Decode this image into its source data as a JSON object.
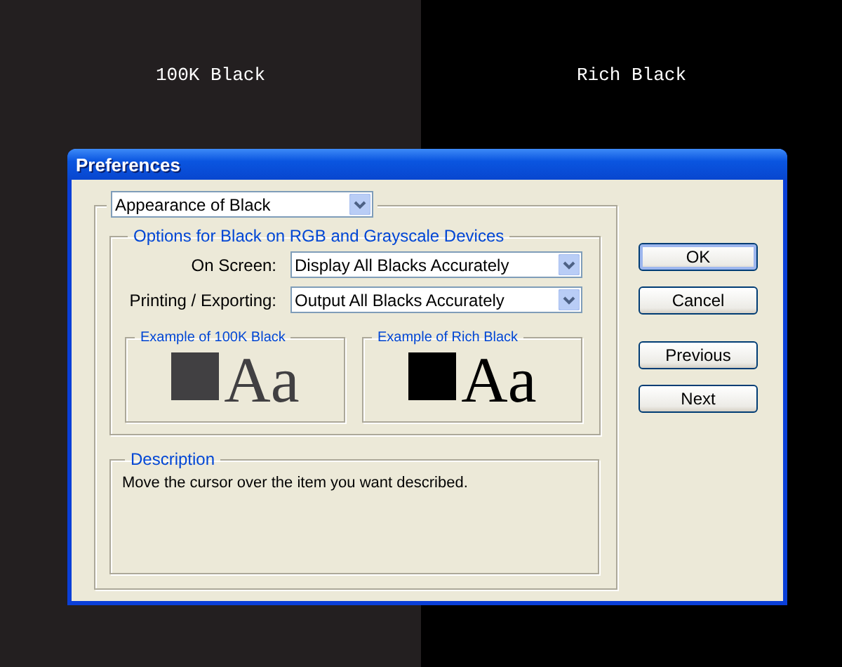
{
  "backdrop": [
    {
      "label": "100K Black"
    },
    {
      "label": "Rich Black"
    }
  ],
  "window": {
    "title": "Preferences"
  },
  "section_select": {
    "value": "Appearance of Black"
  },
  "options_group": {
    "title": "Options for Black on RGB and Grayscale Devices",
    "rows": [
      {
        "label": "On Screen:",
        "value": "Display All Blacks Accurately"
      },
      {
        "label": "Printing / Exporting:",
        "value": "Output All Blacks Accurately"
      }
    ],
    "examples": [
      {
        "title": "Example of 100K Black",
        "sample": "Aa",
        "color": "#414042"
      },
      {
        "title": "Example of Rich Black",
        "sample": "Aa",
        "color": "#000000"
      }
    ]
  },
  "description": {
    "title": "Description",
    "text": "Move the cursor over the item you want described."
  },
  "buttons": [
    {
      "label": "OK",
      "default": true
    },
    {
      "label": "Cancel",
      "default": false
    },
    {
      "label": "Previous",
      "default": false
    },
    {
      "label": "Next",
      "default": false
    }
  ]
}
